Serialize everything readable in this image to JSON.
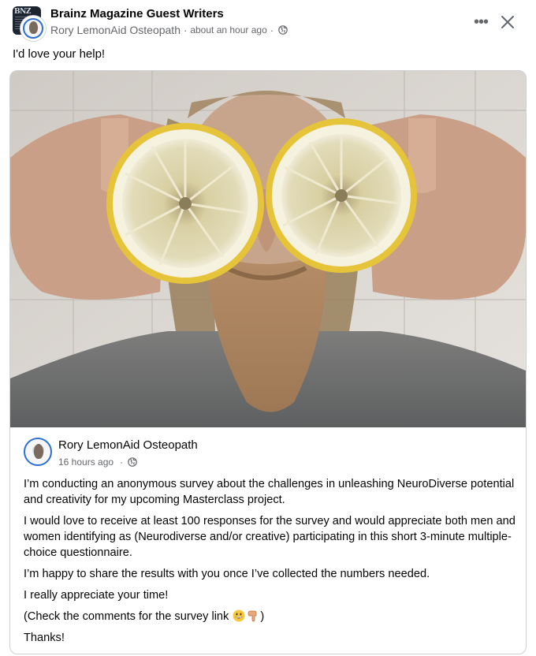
{
  "header": {
    "group_name": "Brainz Magazine Guest Writers",
    "author": "Rory LemonAid Osteopath",
    "separator": "·",
    "time": "about an hour ago",
    "visibility_icon": "globe-icon",
    "more_icon": "more-options-icon",
    "more_label": "•••",
    "close_icon": "close-icon"
  },
  "post": {
    "text": "I'd love your help!"
  },
  "shared": {
    "image_alt": "Man with long hair and beard holding two lemon halves over his eyes",
    "author": "Rory LemonAid Osteopath",
    "separator": "·",
    "time": "16 hours ago",
    "visibility_icon": "globe-icon",
    "paragraphs": [
      "I’m conducting an anonymous survey about the challenges in unleashing NeuroDiverse potential and creativity for my upcoming Masterclass project.",
      "I would love to receive at least 100 responses for the survey and would appreciate both men and women identifying as (Neurodiverse and/or creative) participating in this short 3-minute multiple-choice questionnaire.",
      "I’m happy to share the results with you once I’ve collected the numbers needed.",
      "I really appreciate your time!"
    ],
    "comments_prefix": "(Check the comments for the survey link ",
    "comments_suffix": ")",
    "comments_emojis": [
      "grinning-face-emoji",
      "backhand-index-pointing-down-emoji"
    ],
    "thanks": "Thanks!"
  },
  "colors": {
    "text_primary": "#050505",
    "text_secondary": "#65676b",
    "border": "#ced0d4",
    "avatar_ring": "#2e6fd6"
  }
}
